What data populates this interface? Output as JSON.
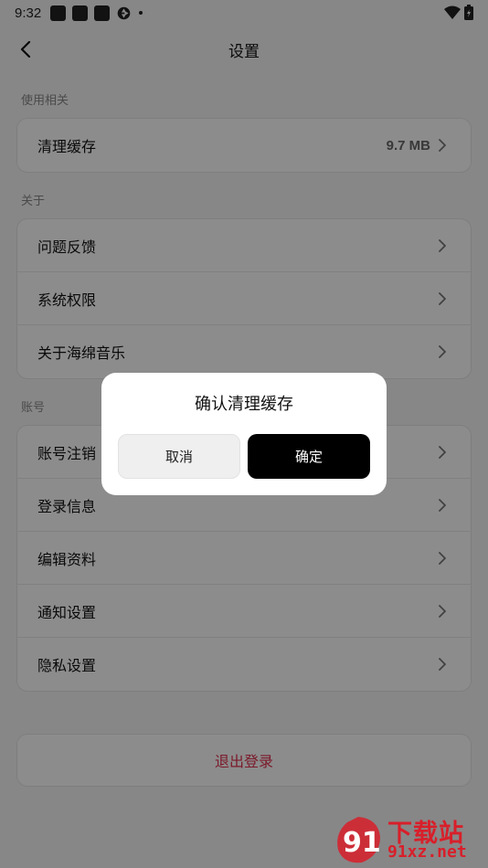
{
  "status_bar": {
    "time": "9:32"
  },
  "header": {
    "title": "设置"
  },
  "sections": {
    "storage": {
      "label": "使用相关",
      "items": [
        {
          "label": "清理缓存",
          "value": "9.7 MB"
        }
      ]
    },
    "about": {
      "label": "关于",
      "items": [
        {
          "label": "问题反馈"
        },
        {
          "label": "系统权限"
        },
        {
          "label": "关于海绵音乐"
        }
      ]
    },
    "account": {
      "label": "账号",
      "items": [
        {
          "label": "账号注销"
        },
        {
          "label": "登录信息"
        },
        {
          "label": "编辑资料"
        },
        {
          "label": "通知设置"
        },
        {
          "label": "隐私设置"
        }
      ]
    }
  },
  "logout": {
    "label": "退出登录"
  },
  "dialog": {
    "title": "确认清理缓存",
    "cancel": "取消",
    "confirm": "确定"
  },
  "watermark": {
    "title": "下载站",
    "url": "91xz.net",
    "logo_text": "91"
  },
  "colors": {
    "accent_red": "#e0304f",
    "watermark_red": "#d81f2a",
    "confirm_bg": "#000000"
  }
}
